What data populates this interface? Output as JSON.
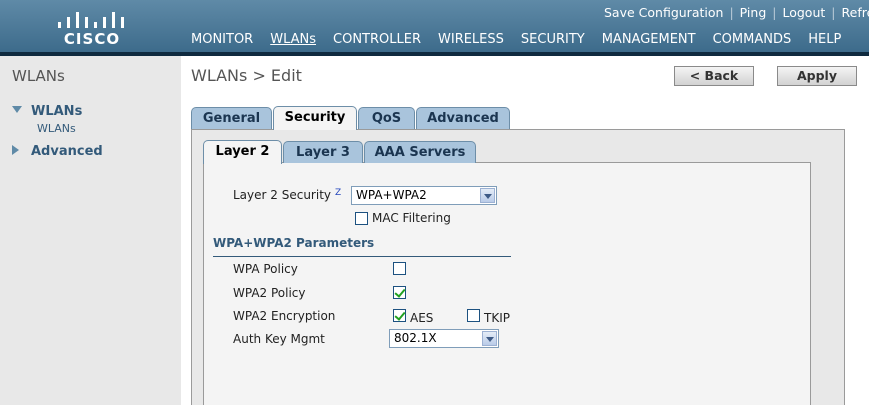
{
  "brand": {
    "logo_text": "CISCO"
  },
  "utility_links": [
    "Save Configuration",
    "Ping",
    "Logout",
    "Refresh"
  ],
  "main_nav": [
    "MONITOR",
    "WLANs",
    "CONTROLLER",
    "WIRELESS",
    "SECURITY",
    "MANAGEMENT",
    "COMMANDS",
    "HELP"
  ],
  "main_nav_active": "WLANs",
  "sidebar": {
    "title": "WLANs",
    "items": [
      {
        "label": "WLANs",
        "expanded": true,
        "children": [
          "WLANs"
        ]
      },
      {
        "label": "Advanced",
        "expanded": false
      }
    ]
  },
  "page": {
    "title": "WLANs > Edit",
    "back_label": "< Back",
    "apply_label": "Apply"
  },
  "tabs": [
    "General",
    "Security",
    "QoS",
    "Advanced"
  ],
  "active_tab": "Security",
  "subtabs": [
    "Layer 2",
    "Layer 3",
    "AAA Servers"
  ],
  "active_subtab": "Layer 2",
  "layer2": {
    "security_label": "Layer 2 Security",
    "help_marker": "Z",
    "security_value": "WPA+WPA2",
    "mac_filtering_label": "MAC Filtering",
    "mac_filtering": false
  },
  "wpa_params": {
    "title": "WPA+WPA2 Parameters",
    "wpa_policy_label": "WPA Policy",
    "wpa_policy": false,
    "wpa2_policy_label": "WPA2 Policy",
    "wpa2_policy": true,
    "wpa2_encryption_label": "WPA2 Encryption",
    "aes_label": "AES",
    "aes": true,
    "tkip_label": "TKIP",
    "tkip": false,
    "auth_key_label": "Auth Key Mgmt",
    "auth_key_value": "802.1X"
  },
  "colors": {
    "header": "#4a7798",
    "header_bottom": "#0f2a3f",
    "sidebar_bg": "#e8e8e8",
    "tab_inactive": "#a9c4dc",
    "accent_text": "#335a7a"
  }
}
